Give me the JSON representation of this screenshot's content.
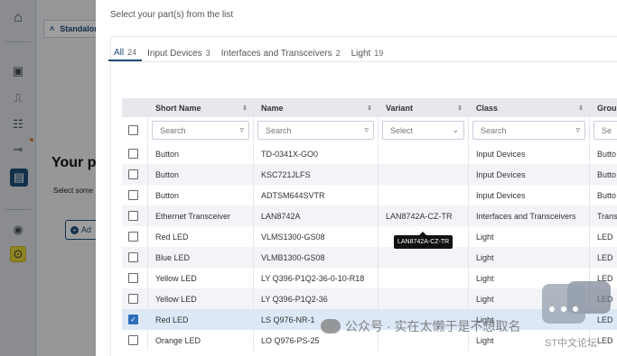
{
  "rail": {
    "icons": [
      "home-icon",
      "chip-icon",
      "pulse-icon",
      "settings-sliders-icon",
      "signal-icon",
      "board-icon",
      "target-icon",
      "info-icon"
    ]
  },
  "background": {
    "tab_label": "Standalon",
    "title": "Your p",
    "subtitle": "Select some",
    "add_button": "Ad"
  },
  "dialog": {
    "title": "Select your part(s) from the list",
    "tabs": [
      {
        "label": "All",
        "count": "24",
        "selected": true
      },
      {
        "label": "Input Devices",
        "count": "3",
        "selected": false
      },
      {
        "label": "Interfaces and Transceivers",
        "count": "2",
        "selected": false
      },
      {
        "label": "Light",
        "count": "19",
        "selected": false
      }
    ],
    "columns": [
      "Short Name",
      "Name",
      "Variant",
      "Class",
      "Grou"
    ],
    "filters": {
      "short_name": "Search",
      "name": "Search",
      "variant": "Select",
      "class": "Search",
      "group": "Se"
    },
    "rows": [
      {
        "short": "Button",
        "name": "TD-0341X-GO0",
        "variant": "",
        "class": "Input Devices",
        "group": "Butto",
        "checked": false
      },
      {
        "short": "Button",
        "name": "KSC721JLFS",
        "variant": "",
        "class": "Input Devices",
        "group": "Butto",
        "checked": false
      },
      {
        "short": "Button",
        "name": "ADTSM644SVTR",
        "variant": "",
        "class": "Input Devices",
        "group": "Butto",
        "checked": false
      },
      {
        "short": "Ethernet Transceiver",
        "name": "LAN8742A",
        "variant": "LAN8742A-CZ-TR",
        "class": "Interfaces and Transceivers",
        "group": "Trans",
        "checked": false
      },
      {
        "short": "Red LED",
        "name": "VLMS1300-GS08",
        "variant": "",
        "class": "Light",
        "group": "LED",
        "checked": false
      },
      {
        "short": "Blue LED",
        "name": "VLMB1300-GS08",
        "variant": "",
        "class": "Light",
        "group": "LED",
        "checked": false
      },
      {
        "short": "Yellow LED",
        "name": "LY Q396-P1Q2-36-0-10-R18",
        "variant": "",
        "class": "Light",
        "group": "LED",
        "checked": false
      },
      {
        "short": "Yellow LED",
        "name": "LY Q396-P1Q2-36",
        "variant": "",
        "class": "Light",
        "group": "LED",
        "checked": false
      },
      {
        "short": "Red LED",
        "name": "LS Q976-NR-1",
        "variant": "",
        "class": "Light",
        "group": "LED",
        "checked": true
      },
      {
        "short": "Orange LED",
        "name": "LO Q976-PS-25",
        "variant": "",
        "class": "Light",
        "group": "LED",
        "checked": false
      }
    ],
    "tooltip": "LAN8742A-CZ-TR"
  },
  "watermark": {
    "text": "公众号 · 实在太懒于是不想取名",
    "text2": "ST中文论坛"
  },
  "colors": {
    "accent": "#1f4e79",
    "checkbox_on": "#2d6fb8",
    "selected_row": "#dde8f6"
  }
}
